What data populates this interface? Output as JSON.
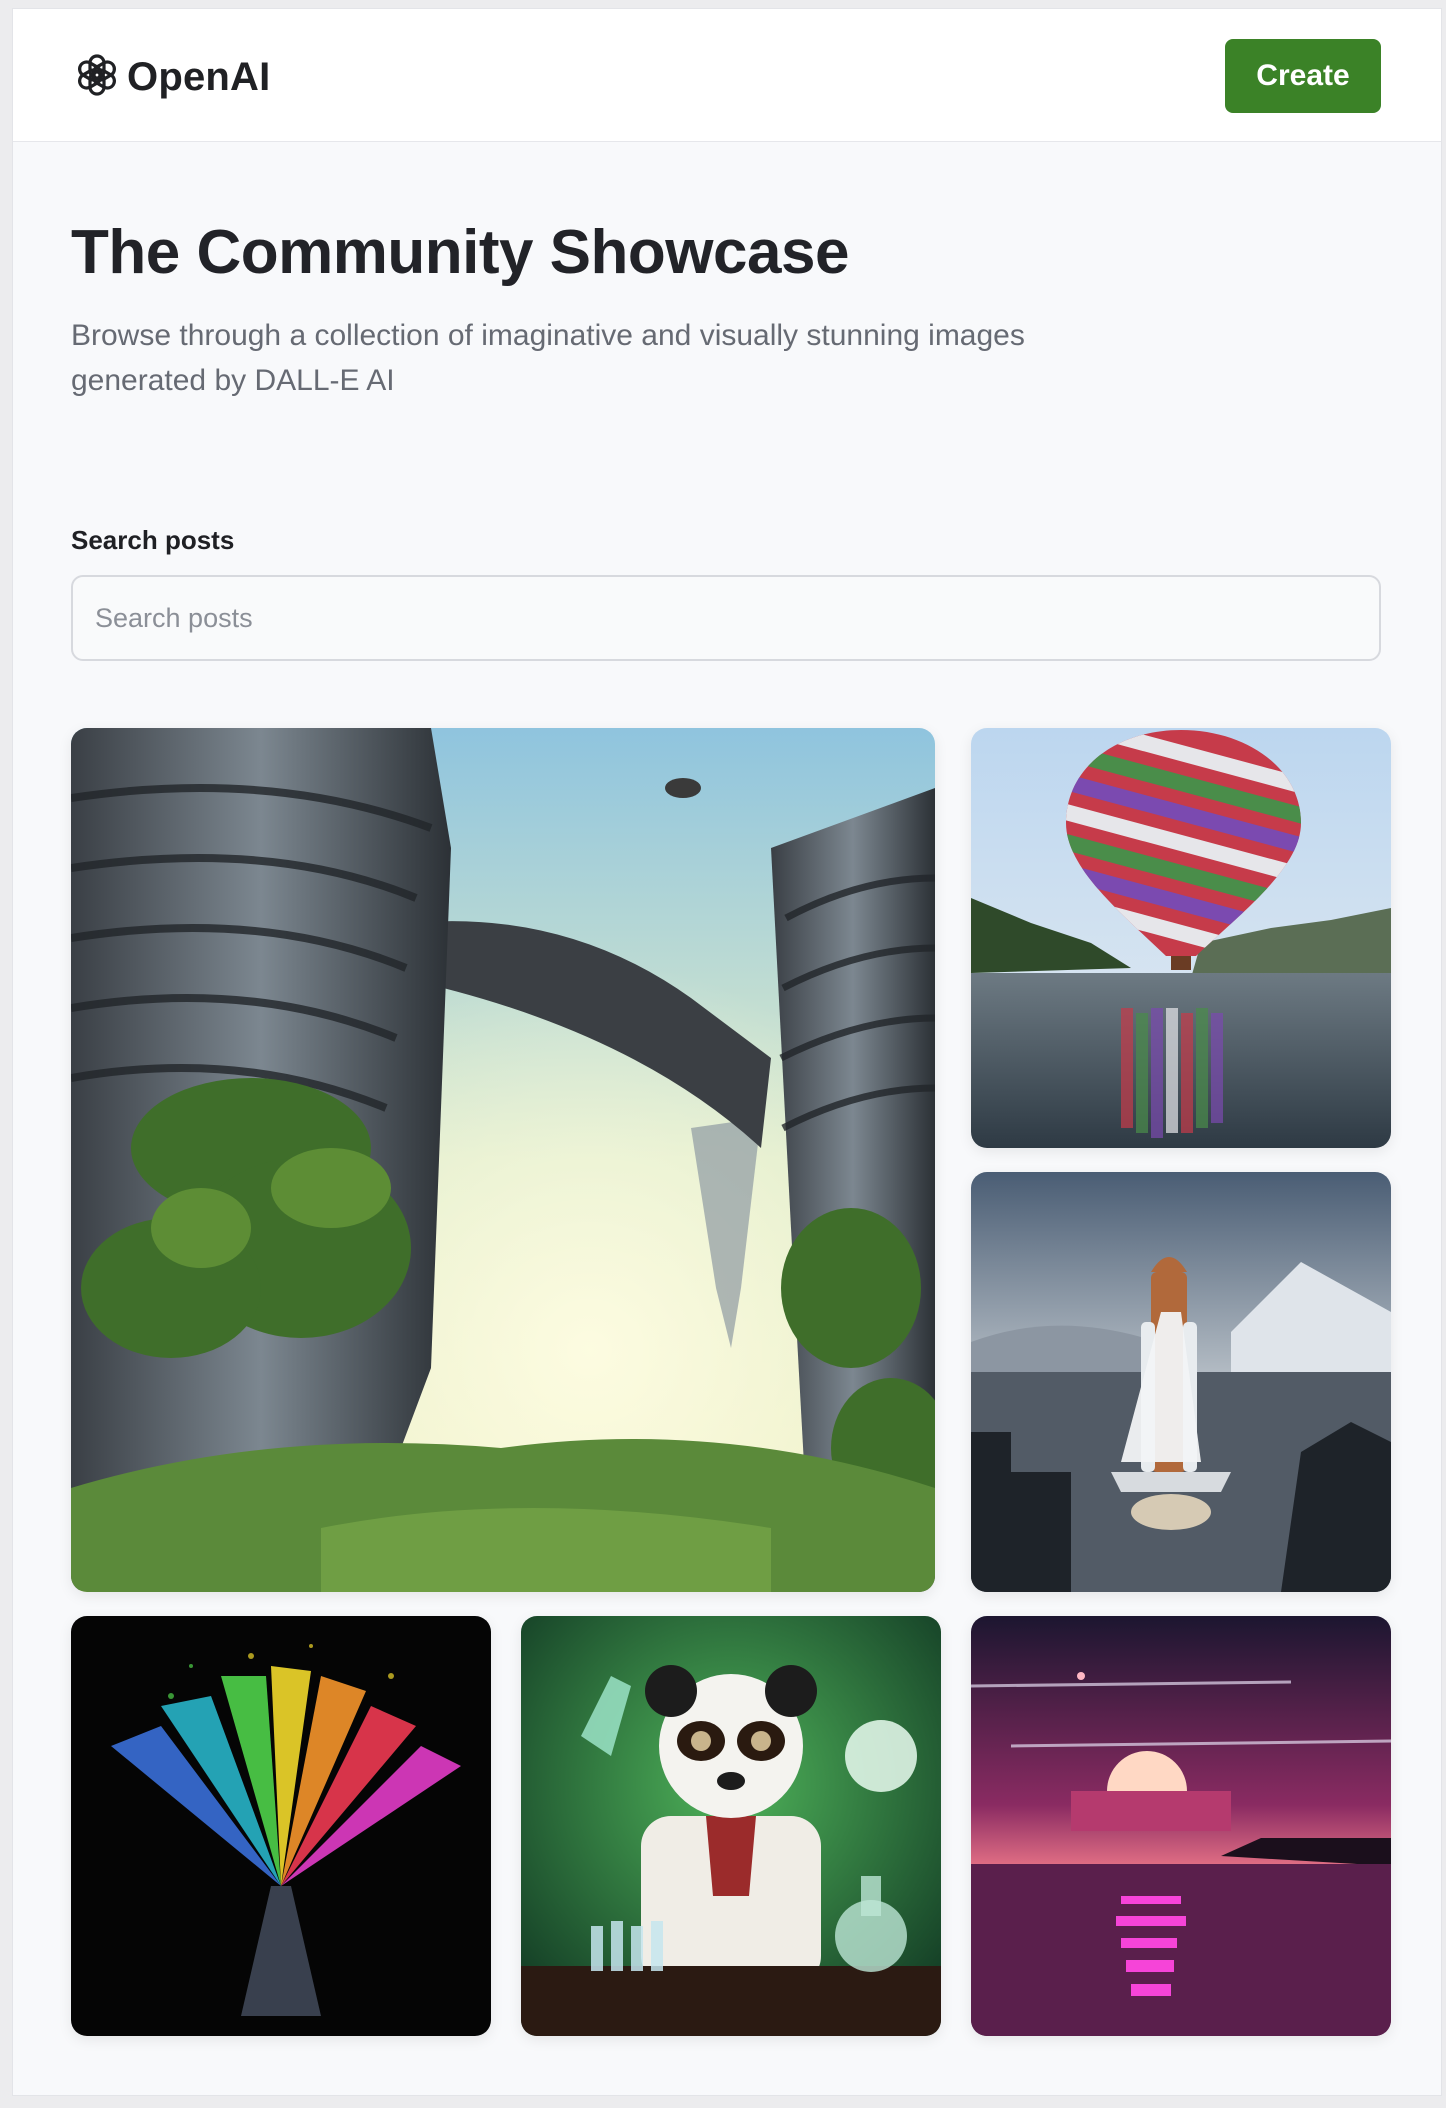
{
  "brand": {
    "name": "OpenAI",
    "logo_icon": "openai-knot-icon"
  },
  "header": {
    "create_label": "Create",
    "create_color": "#3b8227"
  },
  "hero": {
    "title": "The Community Showcase",
    "subtitle": "Browse through a collection of imaginative and visually stunning images generated by DALL-E AI"
  },
  "search": {
    "label": "Search posts",
    "placeholder": "Search posts",
    "value": ""
  },
  "gallery": {
    "items": [
      {
        "name": "futuristic-towers-jungle-image"
      },
      {
        "name": "striped-hot-air-balloon-image"
      },
      {
        "name": "space-shuttle-launch-image"
      },
      {
        "name": "rainbow-powder-explosion-image"
      },
      {
        "name": "panda-scientist-image"
      },
      {
        "name": "pink-sunset-sea-image"
      }
    ]
  }
}
